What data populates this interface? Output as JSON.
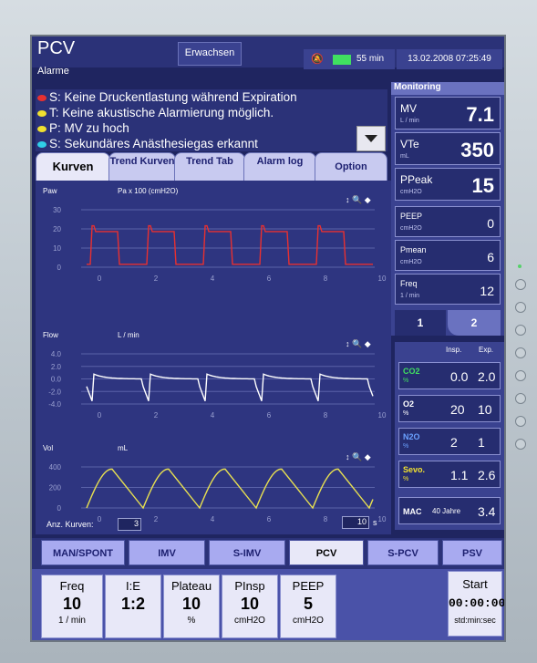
{
  "header": {
    "mode": "PCV",
    "patient": "Erwachsen",
    "battery_time": "55 min",
    "datetime": "13.02.2008 07:25:49"
  },
  "alarms": {
    "title": "Alarme",
    "items": [
      {
        "text": "S: Keine Druckentlastung während Expiration",
        "color": "#e83030"
      },
      {
        "text": "T: Keine akustische Alarmierung möglich.",
        "color": "#f0e030"
      },
      {
        "text": "P: MV zu hoch",
        "color": "#f0e030"
      },
      {
        "text": "S: Sekundäres Anästhesiegas erkannt",
        "color": "#30d0e8"
      }
    ]
  },
  "tabs": [
    {
      "label": "Kurven"
    },
    {
      "label": "Trend Kurven"
    },
    {
      "label": "Trend Tab"
    },
    {
      "label": "Alarm log"
    },
    {
      "label": "Option"
    }
  ],
  "graphs": [
    {
      "name": "Paw",
      "unit": "Pa x 100 (cmH2O)",
      "yticks": [
        "30",
        "20",
        "10",
        "0"
      ],
      "color": "#e83030"
    },
    {
      "name": "Flow",
      "unit": "L / min",
      "yticks": [
        "4.0",
        "2.0",
        "0.0",
        "-2.0",
        "-4.0"
      ],
      "color": "#ffffff"
    },
    {
      "name": "Vol",
      "unit": "mL",
      "yticks": [
        "400",
        "200",
        "0"
      ],
      "color": "#e8e050"
    }
  ],
  "xticks": [
    "0",
    "2",
    "4",
    "6",
    "8",
    "10"
  ],
  "curves": {
    "label": "Anz. Kurven:",
    "count": "3",
    "seconds": "10",
    "sec_unit": "s"
  },
  "monitoring": {
    "title": "Monitoring",
    "cells": [
      {
        "label": "MV",
        "unit": "L / min",
        "value": "7.1"
      },
      {
        "label": "VTe",
        "unit": "mL",
        "value": "350"
      },
      {
        "label": "PPeak",
        "unit": "cmH2O",
        "value": "15"
      },
      {
        "label": "PEEP",
        "unit": "cmH2O",
        "value": "0"
      },
      {
        "label": "Pmean",
        "unit": "cmH2O",
        "value": "6"
      },
      {
        "label": "Freq",
        "unit": "1 / min",
        "value": "12"
      }
    ],
    "tab1": "1",
    "tab2": "2"
  },
  "gas": {
    "insp_label": "Insp.",
    "exp_label": "Exp.",
    "rows": [
      {
        "label": "CO2",
        "unit": "%",
        "insp": "0.0",
        "exp": "2.0",
        "color": "#40e060"
      },
      {
        "label": "O2",
        "unit": "%",
        "insp": "20",
        "exp": "10",
        "color": "#ffffff"
      },
      {
        "label": "N2O",
        "unit": "%",
        "insp": "2",
        "exp": "1",
        "color": "#6aa0ff"
      },
      {
        "label": "Sevo.",
        "unit": "%",
        "insp": "1.1",
        "exp": "2.6",
        "color": "#f0e030"
      }
    ],
    "mac_label": "MAC",
    "mac_age": "40 Jahre",
    "mac_value": "3.4"
  },
  "modes": [
    "MAN/SPONT",
    "IMV",
    "S-IMV",
    "PCV",
    "S-PCV",
    "PSV"
  ],
  "params": [
    {
      "label": "Freq",
      "value": "10",
      "unit": "1 / min"
    },
    {
      "label": "I:E",
      "value": "1:2",
      "unit": ""
    },
    {
      "label": "Plateau",
      "value": "10",
      "unit": "%"
    },
    {
      "label": "PInsp",
      "value": "10",
      "unit": "cmH2O"
    },
    {
      "label": "PEEP",
      "value": "5",
      "unit": "cmH2O"
    }
  ],
  "start": {
    "label": "Start",
    "time": "00:00:00",
    "format": "std:min:sec"
  }
}
